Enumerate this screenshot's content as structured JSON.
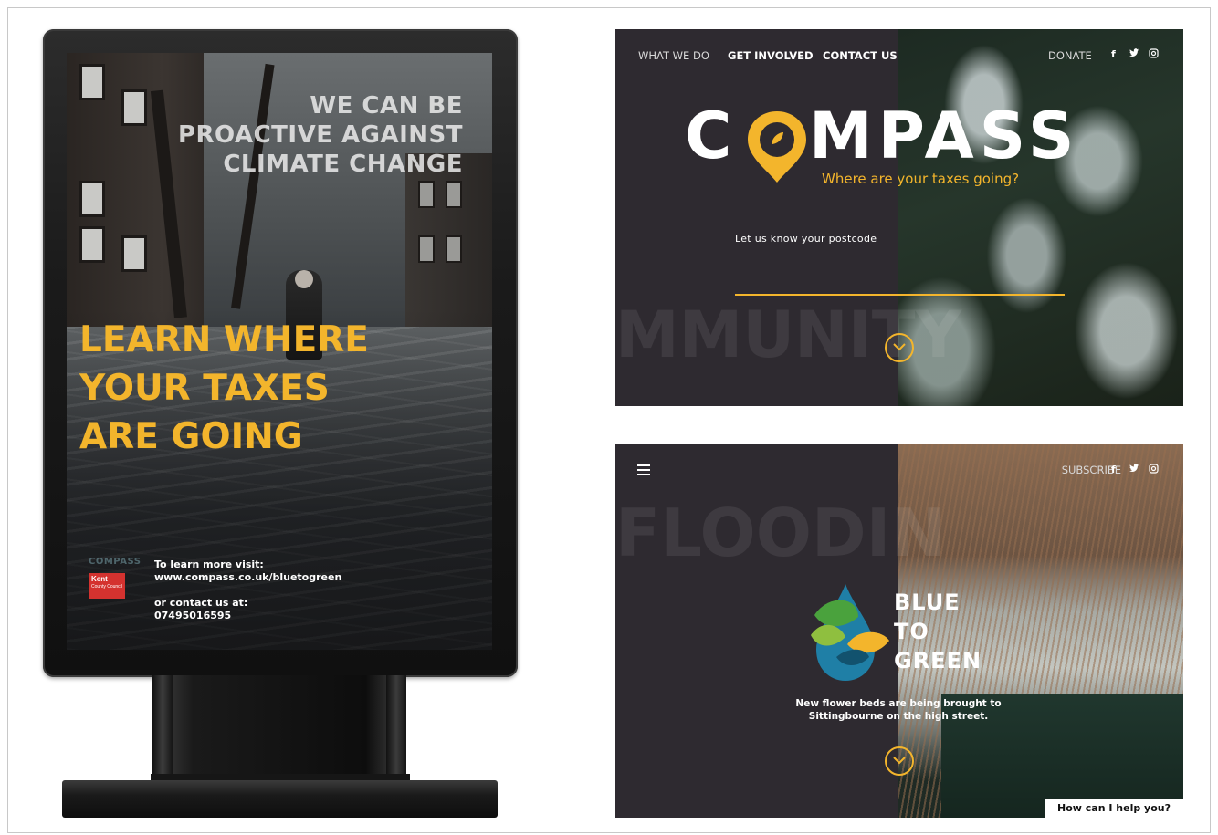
{
  "poster": {
    "headline_lines": [
      "WE CAN BE",
      "PROACTIVE AGAINST",
      "CLIMATE CHANGE"
    ],
    "cta_lines": [
      "LEARN WHERE",
      "YOUR TAXES",
      "ARE GOING"
    ],
    "brand": "COMPASS",
    "council_logo_text": "Kent",
    "council_logo_sub": "County Council",
    "visit_label": "To learn more visit:",
    "visit_url": "www.compass.co.uk/bluetogreen",
    "contact_label": "or contact us at:",
    "contact_phone": "07495016595",
    "accent_color": "#f3b52c"
  },
  "site_home": {
    "nav": [
      "WHAT WE DO",
      "GET INVOLVED",
      "CONTACT US"
    ],
    "donate": "DONATE",
    "social_icons": [
      "facebook-icon",
      "twitter-icon",
      "instagram-icon"
    ],
    "logo_left": "C",
    "logo_right": "MPASS",
    "tagline": "Where are your taxes going?",
    "postcode_label": "Let us know your postcode",
    "postcode_value": "",
    "background_word": "MMUNITY"
  },
  "site_article": {
    "subscribe": "SUBSCRIBE",
    "background_word": "FLOODIN",
    "title_lines": [
      "BLUE",
      "TO",
      "GREEN"
    ],
    "description": "New flower beds are being brought to Sittingbourne on the high street.",
    "chat_prompt": "How can I help you?"
  }
}
